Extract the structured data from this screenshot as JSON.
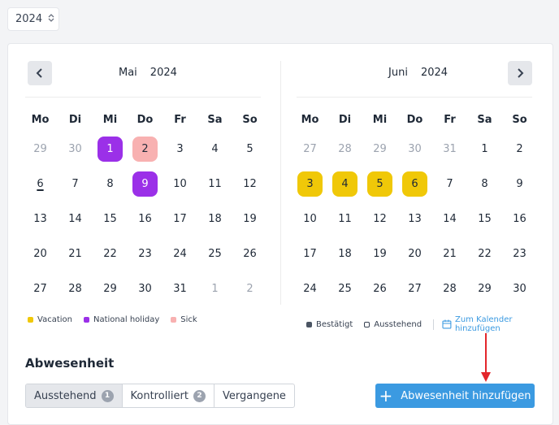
{
  "year_select": {
    "value": "2024"
  },
  "weekdays": [
    "Mo",
    "Di",
    "Mi",
    "Do",
    "Fr",
    "Sa",
    "So"
  ],
  "calendars": [
    {
      "month": "Mai",
      "year": "2024",
      "weeks": [
        [
          {
            "d": "29",
            "m": 1
          },
          {
            "d": "30",
            "m": 1
          },
          {
            "d": "1",
            "t": "national"
          },
          {
            "d": "2",
            "t": "sick"
          },
          {
            "d": "3"
          },
          {
            "d": "4"
          },
          {
            "d": "5"
          }
        ],
        [
          {
            "d": "6",
            "today": 1
          },
          {
            "d": "7"
          },
          {
            "d": "8"
          },
          {
            "d": "9",
            "t": "national"
          },
          {
            "d": "10"
          },
          {
            "d": "11"
          },
          {
            "d": "12"
          }
        ],
        [
          {
            "d": "13"
          },
          {
            "d": "14"
          },
          {
            "d": "15"
          },
          {
            "d": "16"
          },
          {
            "d": "17"
          },
          {
            "d": "18"
          },
          {
            "d": "19"
          }
        ],
        [
          {
            "d": "20"
          },
          {
            "d": "21"
          },
          {
            "d": "22"
          },
          {
            "d": "23"
          },
          {
            "d": "24"
          },
          {
            "d": "25"
          },
          {
            "d": "26"
          }
        ],
        [
          {
            "d": "27"
          },
          {
            "d": "28"
          },
          {
            "d": "29"
          },
          {
            "d": "30"
          },
          {
            "d": "31"
          },
          {
            "d": "1",
            "m": 1
          },
          {
            "d": "2",
            "m": 1
          }
        ]
      ]
    },
    {
      "month": "Juni",
      "year": "2024",
      "weeks": [
        [
          {
            "d": "27",
            "m": 1
          },
          {
            "d": "28",
            "m": 1
          },
          {
            "d": "29",
            "m": 1
          },
          {
            "d": "30",
            "m": 1
          },
          {
            "d": "31",
            "m": 1
          },
          {
            "d": "1"
          },
          {
            "d": "2"
          }
        ],
        [
          {
            "d": "3",
            "t": "vacation"
          },
          {
            "d": "4",
            "t": "vacation"
          },
          {
            "d": "5",
            "t": "vacation"
          },
          {
            "d": "6",
            "t": "vacation"
          },
          {
            "d": "7"
          },
          {
            "d": "8"
          },
          {
            "d": "9"
          }
        ],
        [
          {
            "d": "10"
          },
          {
            "d": "11"
          },
          {
            "d": "12"
          },
          {
            "d": "13"
          },
          {
            "d": "14"
          },
          {
            "d": "15"
          },
          {
            "d": "16"
          }
        ],
        [
          {
            "d": "17"
          },
          {
            "d": "18"
          },
          {
            "d": "19"
          },
          {
            "d": "20"
          },
          {
            "d": "21"
          },
          {
            "d": "22"
          },
          {
            "d": "23"
          }
        ],
        [
          {
            "d": "24"
          },
          {
            "d": "25"
          },
          {
            "d": "26"
          },
          {
            "d": "27"
          },
          {
            "d": "28"
          },
          {
            "d": "29"
          },
          {
            "d": "30"
          }
        ]
      ]
    }
  ],
  "colors": {
    "vacation": "#f0c808",
    "national": "#9b30e8",
    "sick": "#f8b1b1",
    "confirmed": "#4b5563",
    "accent": "#3b9ae1"
  },
  "legend_left": [
    {
      "label": "Vacation",
      "type": "vacation"
    },
    {
      "label": "National holiday",
      "type": "national"
    },
    {
      "label": "Sick",
      "type": "sick"
    }
  ],
  "legend_right": {
    "confirmed": "Bestätigt",
    "pending": "Ausstehend",
    "calendar_link": "Zum Kalender hinzufügen"
  },
  "section_title": "Abwesenheit",
  "tabs": [
    {
      "label": "Ausstehend",
      "count": "1"
    },
    {
      "label": "Kontrolliert",
      "count": "2"
    },
    {
      "label": "Vergangene"
    }
  ],
  "add_button": {
    "label": "Abwesenheit hinzufügen"
  }
}
